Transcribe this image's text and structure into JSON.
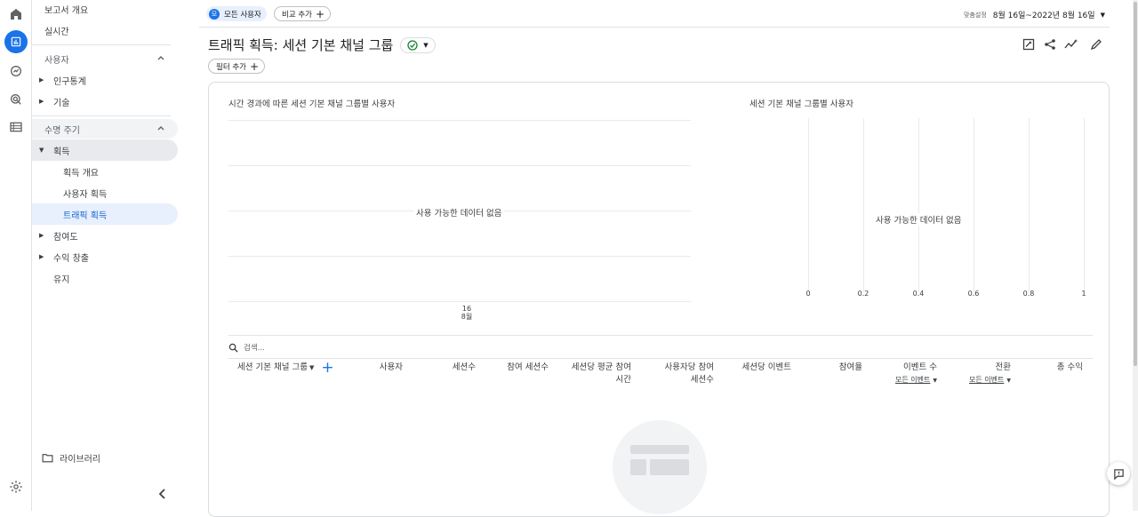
{
  "sidebar": {
    "report_overview": "보고서 개요",
    "realtime": "실시간",
    "user_section": "사용자",
    "demographics": "인구통계",
    "tech": "기술",
    "lifecycle_section": "수명 주기",
    "acquisition": "획득",
    "acq_overview": "획득 개요",
    "user_acquisition": "사용자 획득",
    "traffic_acquisition": "트래픽 획득",
    "engagement": "참여도",
    "monetization": "수익 창출",
    "retention": "유지",
    "library": "라이브러리"
  },
  "header": {
    "segment_badge": "모",
    "segment_label": "모든 사용자",
    "add_comparison": "비교 추가",
    "date_prefix": "맞춤설정",
    "date_range": "8월 16일~2022년 8월 16일"
  },
  "page": {
    "title": "트래픽 획득: 세션 기본 채널 그룹",
    "add_filter": "필터 추가"
  },
  "line_chart": {
    "title": "시간 경과에 따른 세션 기본 채널 그룹별 사용자",
    "no_data": "사용 가능한 데이터 없음",
    "x_tick_day": "16",
    "x_tick_month": "8월"
  },
  "bar_chart": {
    "title": "세션 기본 채널 그룹별 사용자",
    "no_data": "사용 가능한 데이터 없음",
    "ticks": [
      "0",
      "0.2",
      "0.4",
      "0.6",
      "0.8",
      "1"
    ]
  },
  "table": {
    "search_placeholder": "검색...",
    "columns": {
      "dimension": "세션 기본 채널 그룹",
      "users": "사용자",
      "sessions": "세션수",
      "engaged_sessions": "참여 세션수",
      "avg_engagement_line1": "세션당 평균 참여",
      "avg_engagement_line2": "시간",
      "engaged_per_user_line1": "사용자당 참여",
      "engaged_per_user_line2": "세션수",
      "events_per_session": "세션당 이벤트",
      "engagement_rate": "참여율",
      "event_count": "이벤트 수",
      "event_count_sub": "모든 이벤트",
      "conversions": "전환",
      "conversions_sub": "모든 이벤트",
      "total_revenue": "총 수익"
    }
  },
  "colors": {
    "accent": "#1a73e8",
    "check": "#188038"
  }
}
